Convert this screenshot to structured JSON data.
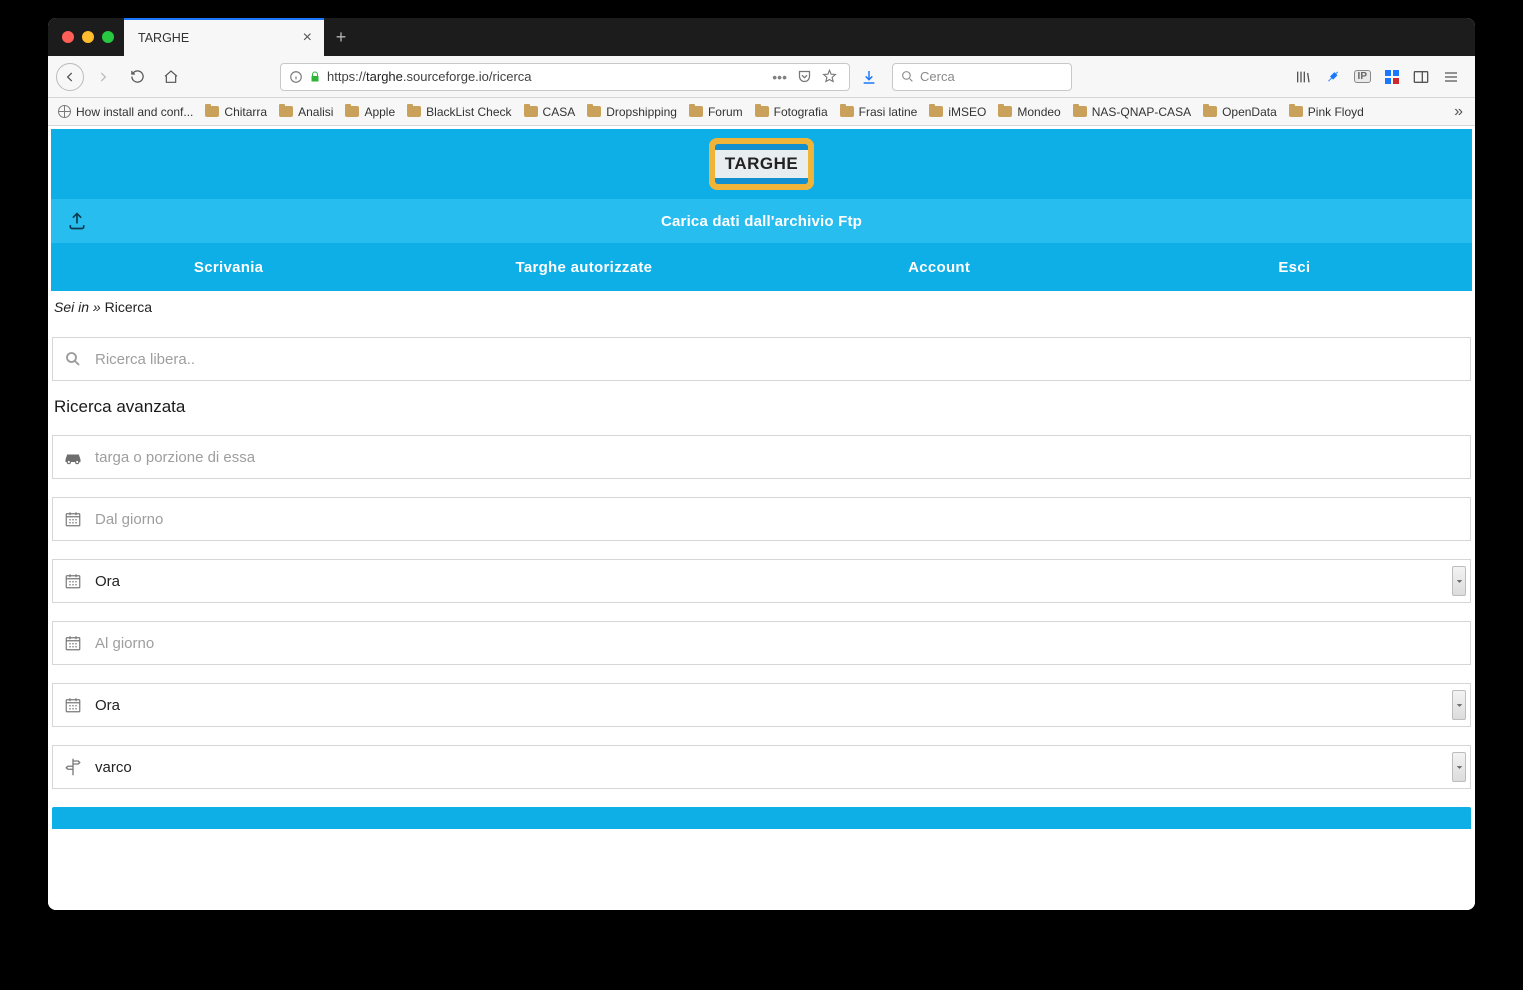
{
  "browser": {
    "tab_title": "TARGHE",
    "url_display_prefix": "https://",
    "url_display_host": "targhe",
    "url_display_rest": ".sourceforge.io/ricerca",
    "search_placeholder": "Cerca"
  },
  "bookmarks": [
    "How install and conf...",
    "Chitarra",
    "Analisi",
    "Apple",
    "BlackList Check",
    "CASA",
    "Dropshipping",
    "Forum",
    "Fotografia",
    "Frasi latine",
    "iMSEO",
    "Mondeo",
    "NAS-QNAP-CASA",
    "OpenData",
    "Pink Floyd"
  ],
  "logo_text": "TARGHE",
  "upload_label": "Carica dati dall'archivio Ftp",
  "nav": {
    "scrivania": "Scrivania",
    "targhe_autor": "Targhe autorizzate",
    "account": "Account",
    "esci": "Esci"
  },
  "breadcrumb": {
    "prefix": "Sei in",
    "sep": "»",
    "current": "Ricerca"
  },
  "search_free_placeholder": "Ricerca libera..",
  "adv_title": "Ricerca avanzata",
  "fields": {
    "targa_placeholder": "targa o porzione di essa",
    "dal_giorno_placeholder": "Dal giorno",
    "ora1": "Ora",
    "al_giorno_placeholder": "Al giorno",
    "ora2": "Ora",
    "varco": "varco"
  }
}
